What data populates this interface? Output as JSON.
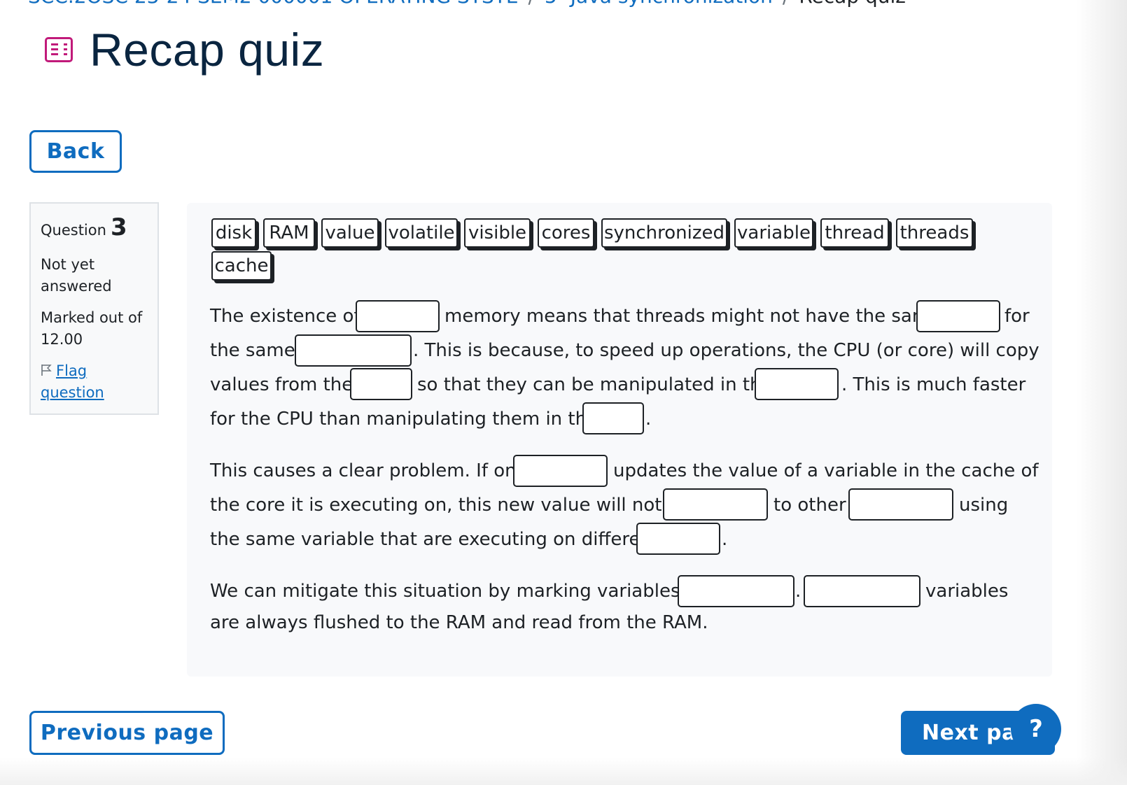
{
  "breadcrumb": {
    "course": "SCC.2OSC 23-24 SEM2 000001 OPERATING SYSTE",
    "section": "5- Java synchronization",
    "current": "Recap quiz"
  },
  "page": {
    "title": "Recap quiz",
    "icon": "quiz-icon",
    "accent_color": "#c11a7a"
  },
  "nav": {
    "back_label": "Back",
    "previous_label": "Previous page",
    "next_label": "Next pag",
    "help_label": "?"
  },
  "question_info": {
    "word": "Question",
    "number": "3",
    "status_line1": "Not yet",
    "status_line2": "answered",
    "marks_line1": "Marked out of",
    "marks_line2": "12.00",
    "flag_line1": "Flag",
    "flag_line2": "question"
  },
  "choices": [
    "disk",
    "RAM",
    "value",
    "volatile",
    "visible",
    "cores",
    "synchronized",
    "variable",
    "thread",
    "threads",
    "cache"
  ],
  "text": {
    "p1_l1_a": "The existence of",
    "p1_l1_b": "memory means that threads might not have the same",
    "p1_l1_c": "for",
    "p1_l2_a": "the same",
    "p1_l2_b": ". This is because, to speed up operations, the CPU (or core) will copy",
    "p1_l3_a": "values from the",
    "p1_l3_b": "so that they can be manipulated in the",
    "p1_l3_c": ". This is much faster",
    "p1_l4_a": "for the CPU than manipulating them in the",
    "p1_l4_b": ".",
    "p2_l1_a": "This causes a clear problem. If one",
    "p2_l1_b": "updates the value of a variable in the cache of",
    "p2_l2_a": "the core it is executing on, this new value will not be",
    "p2_l2_b": "to other",
    "p2_l2_c": "using",
    "p2_l3_a": "the same variable that are executing on different",
    "p2_l3_b": ".",
    "p3_l1_a": "We can mitigate this situation by marking variables as",
    "p3_l1_b": ".",
    "p3_l1_c": "variables",
    "p3_l2_a": "are always flushed to the RAM and read from the RAM."
  },
  "colors": {
    "primary": "#0f6cbf",
    "title": "#0a2540"
  }
}
